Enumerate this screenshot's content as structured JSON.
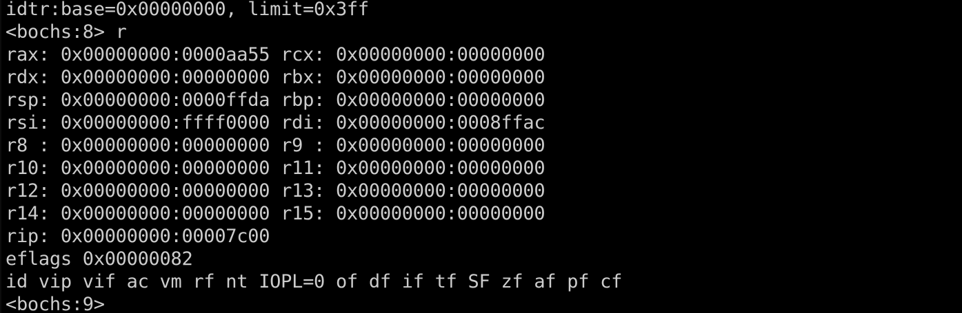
{
  "terminal": {
    "lines": [
      "idtr:base=0x00000000, limit=0x3ff",
      "<bochs:8> r",
      "rax: 0x00000000:0000aa55 rcx: 0x00000000:00000000",
      "rdx: 0x00000000:00000000 rbx: 0x00000000:00000000",
      "rsp: 0x00000000:0000ffda rbp: 0x00000000:00000000",
      "rsi: 0x00000000:ffff0000 rdi: 0x00000000:0008ffac",
      "r8 : 0x00000000:00000000 r9 : 0x00000000:00000000",
      "r10: 0x00000000:00000000 r11: 0x00000000:00000000",
      "r12: 0x00000000:00000000 r13: 0x00000000:00000000",
      "r14: 0x00000000:00000000 r15: 0x00000000:00000000",
      "rip: 0x00000000:00007c00",
      "eflags 0x00000082",
      "id vip vif ac vm rf nt IOPL=0 of df if tf SF zf af pf cf",
      "<bochs:9>"
    ]
  },
  "colors": {
    "background": "#000000",
    "foreground": "#cccccc"
  }
}
